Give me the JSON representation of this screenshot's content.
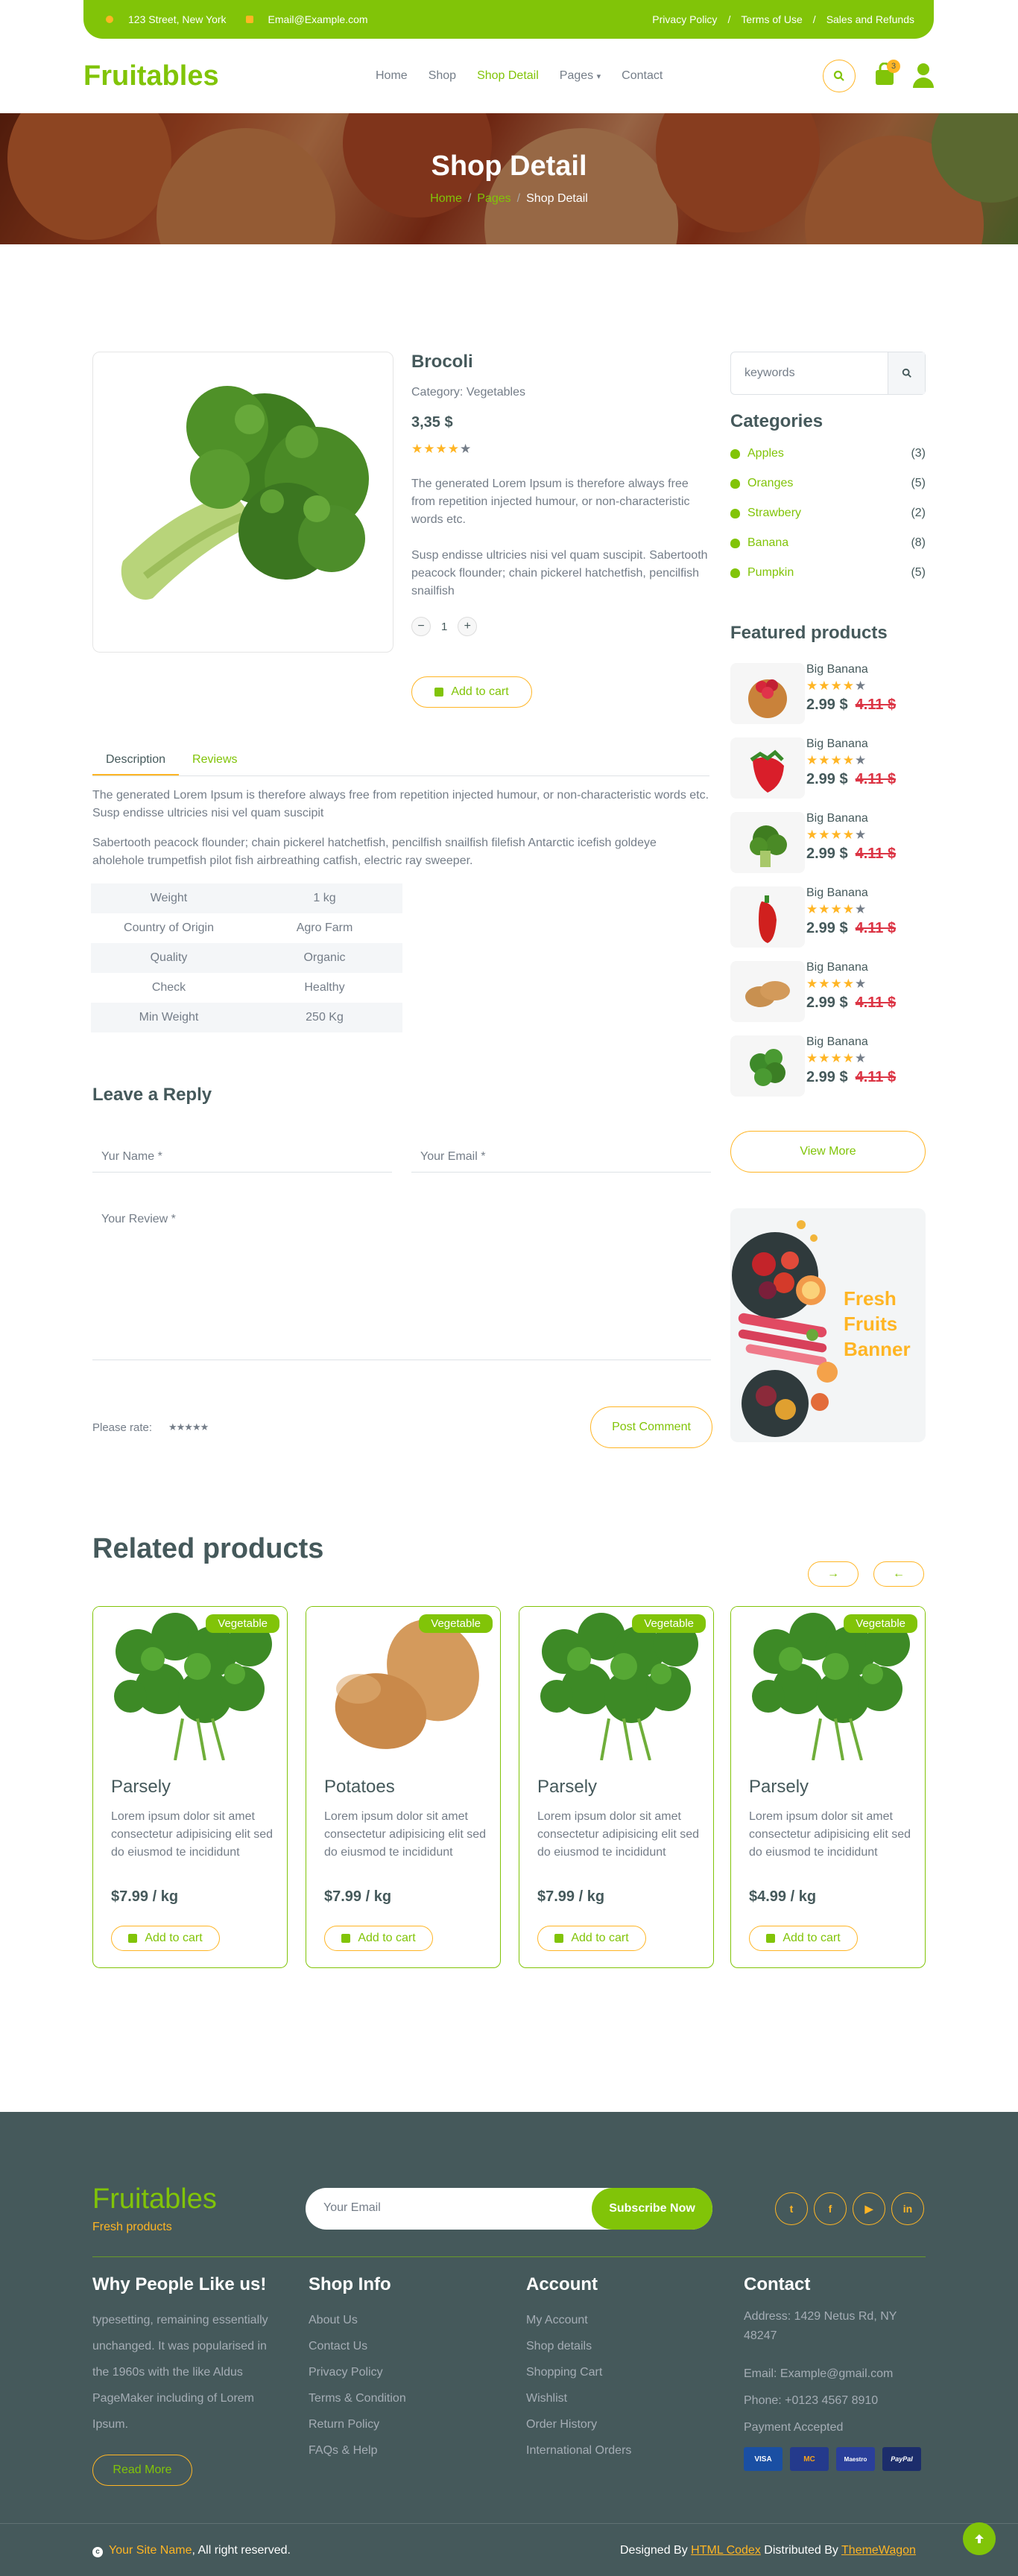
{
  "topbar": {
    "address": "123 Street, New York",
    "email": "Email@Example.com",
    "links": [
      "Privacy Policy",
      "Terms of Use",
      "Sales and Refunds"
    ],
    "sep": "/"
  },
  "nav": {
    "logo": "Fruitables",
    "items": [
      "Home",
      "Shop",
      "Shop Detail",
      "Pages",
      "Contact"
    ],
    "active": "Shop Detail",
    "cart_count": "3"
  },
  "hero": {
    "title": "Shop Detail",
    "crumbs": [
      "Home",
      "Pages",
      "Shop Detail"
    ],
    "sep": "/"
  },
  "product": {
    "name": "Brocoli",
    "category": "Category: Vegetables",
    "price": "3,35 $",
    "rating": 4,
    "desc1": "The generated Lorem Ipsum is therefore always free from repetition injected humour, or non-characteristic words etc.",
    "desc2": "Susp endisse ultricies nisi vel quam suscipit. Sabertooth peacock flounder; chain pickerel hatchetfish, pencilfish snailfish",
    "qty": "1",
    "add": "Add to cart"
  },
  "tabs": [
    "Description",
    "Reviews"
  ],
  "description": {
    "p1": "The generated Lorem Ipsum is therefore always free from repetition injected humour, or non-characteristic words etc. Susp endisse ultricies nisi vel quam suscipit",
    "p2": "Sabertooth peacock flounder; chain pickerel hatchetfish, pencilfish snailfish filefish Antarctic icefish goldeye aholehole trumpetfish pilot fish airbreathing catfish, electric ray sweeper."
  },
  "specs": [
    [
      "Weight",
      "1 kg"
    ],
    [
      "Country of Origin",
      "Agro Farm"
    ],
    [
      "Quality",
      "Organic"
    ],
    [
      "Check",
      "Healthy"
    ],
    [
      "Min Weight",
      "250 Kg"
    ]
  ],
  "reply": {
    "title": "Leave a Reply",
    "name_ph": "Yur Name *",
    "email_ph": "Your Email *",
    "review_ph": "Your Review *",
    "rate_label": "Please rate:",
    "submit": "Post Comment"
  },
  "sidebar": {
    "search_ph": "keywords",
    "cat_title": "Categories",
    "categories": [
      {
        "name": "Apples",
        "count": "(3)"
      },
      {
        "name": "Oranges",
        "count": "(5)"
      },
      {
        "name": "Strawbery",
        "count": "(2)"
      },
      {
        "name": "Banana",
        "count": "(8)"
      },
      {
        "name": "Pumpkin",
        "count": "(5)"
      }
    ],
    "featured_title": "Featured products",
    "featured": [
      {
        "name": "Big Banana",
        "price": "2.99 $",
        "old": "4.11 $",
        "rating": 4
      },
      {
        "name": "Big Banana",
        "price": "2.99 $",
        "old": "4.11 $",
        "rating": 4
      },
      {
        "name": "Big Banana",
        "price": "2.99 $",
        "old": "4.11 $",
        "rating": 4
      },
      {
        "name": "Big Banana",
        "price": "2.99 $",
        "old": "4.11 $",
        "rating": 4
      },
      {
        "name": "Big Banana",
        "price": "2.99 $",
        "old": "4.11 $",
        "rating": 4
      },
      {
        "name": "Big Banana",
        "price": "2.99 $",
        "old": "4.11 $",
        "rating": 4
      }
    ],
    "view_more": "View More",
    "banner": "Fresh Fruits Banner"
  },
  "related": {
    "title": "Related products",
    "items": [
      {
        "badge": "Vegetable",
        "name": "Parsely",
        "desc": "Lorem ipsum dolor sit amet consectetur adipisicing elit sed do eiusmod te incididunt",
        "price": "$7.99 / kg",
        "add": "Add to cart"
      },
      {
        "badge": "Vegetable",
        "name": "Potatoes",
        "desc": "Lorem ipsum dolor sit amet consectetur adipisicing elit sed do eiusmod te incididunt",
        "price": "$7.99 / kg",
        "add": "Add to cart"
      },
      {
        "badge": "Vegetable",
        "name": "Parsely",
        "desc": "Lorem ipsum dolor sit amet consectetur adipisicing elit sed do eiusmod te incididunt",
        "price": "$7.99 / kg",
        "add": "Add to cart"
      },
      {
        "badge": "Vegetable",
        "name": "Parsely",
        "desc": "Lorem ipsum dolor sit amet consectetur adipisicing elit sed do eiusmod te incididunt",
        "price": "$4.99 / kg",
        "add": "Add to cart"
      }
    ]
  },
  "footer": {
    "logo": "Fruitables",
    "tagline": "Fresh products",
    "email_ph": "Your Email",
    "subscribe": "Subscribe Now",
    "social": [
      "twitter-icon",
      "facebook-icon",
      "youtube-icon",
      "linkedin-icon"
    ],
    "why_title": "Why People Like us!",
    "why_text": "typesetting, remaining essentially unchanged. It was popularised in the 1960s with the like Aldus PageMaker including of Lorem Ipsum.",
    "read_more": "Read More",
    "shop_title": "Shop Info",
    "shop_links": [
      "About Us",
      "Contact Us",
      "Privacy Policy",
      "Terms & Condition",
      "Return Policy",
      "FAQs & Help"
    ],
    "acc_title": "Account",
    "acc_links": [
      "My Account",
      "Shop details",
      "Shopping Cart",
      "Wishlist",
      "Order History",
      "International Orders"
    ],
    "contact_title": "Contact",
    "address": "Address: 1429 Netus Rd, NY 48247",
    "email": "Email: Example@gmail.com",
    "phone": "Phone: +0123 4567 8910",
    "payment": "Payment Accepted",
    "cards": [
      "VISA",
      "MC",
      "Maestro",
      "PayPal"
    ],
    "copyright_site": "Your Site Name",
    "copyright_rest": ", All right reserved.",
    "designed_by": "Designed By",
    "designer": "HTML Codex",
    "distributed_by": "Distributed By",
    "distributor": "ThemeWagon"
  },
  "colors": {
    "primary": "#81c408",
    "secondary": "#ffb524",
    "dark": "#45595b",
    "muted": "#747d88",
    "danger": "#dc3545"
  }
}
